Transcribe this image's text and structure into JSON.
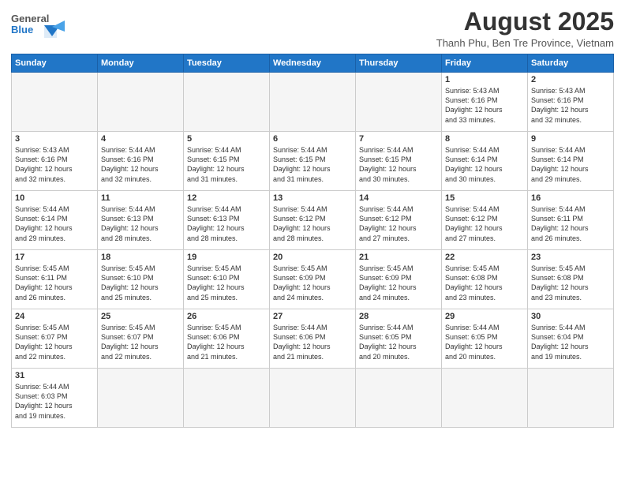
{
  "header": {
    "logo_text_general": "General",
    "logo_text_blue": "Blue",
    "month_title": "August 2025",
    "location": "Thanh Phu, Ben Tre Province, Vietnam"
  },
  "calendar": {
    "days_of_week": [
      "Sunday",
      "Monday",
      "Tuesday",
      "Wednesday",
      "Thursday",
      "Friday",
      "Saturday"
    ],
    "weeks": [
      [
        {
          "day": "",
          "info": ""
        },
        {
          "day": "",
          "info": ""
        },
        {
          "day": "",
          "info": ""
        },
        {
          "day": "",
          "info": ""
        },
        {
          "day": "",
          "info": ""
        },
        {
          "day": "1",
          "info": "Sunrise: 5:43 AM\nSunset: 6:16 PM\nDaylight: 12 hours\nand 33 minutes."
        },
        {
          "day": "2",
          "info": "Sunrise: 5:43 AM\nSunset: 6:16 PM\nDaylight: 12 hours\nand 32 minutes."
        }
      ],
      [
        {
          "day": "3",
          "info": "Sunrise: 5:43 AM\nSunset: 6:16 PM\nDaylight: 12 hours\nand 32 minutes."
        },
        {
          "day": "4",
          "info": "Sunrise: 5:44 AM\nSunset: 6:16 PM\nDaylight: 12 hours\nand 32 minutes."
        },
        {
          "day": "5",
          "info": "Sunrise: 5:44 AM\nSunset: 6:15 PM\nDaylight: 12 hours\nand 31 minutes."
        },
        {
          "day": "6",
          "info": "Sunrise: 5:44 AM\nSunset: 6:15 PM\nDaylight: 12 hours\nand 31 minutes."
        },
        {
          "day": "7",
          "info": "Sunrise: 5:44 AM\nSunset: 6:15 PM\nDaylight: 12 hours\nand 30 minutes."
        },
        {
          "day": "8",
          "info": "Sunrise: 5:44 AM\nSunset: 6:14 PM\nDaylight: 12 hours\nand 30 minutes."
        },
        {
          "day": "9",
          "info": "Sunrise: 5:44 AM\nSunset: 6:14 PM\nDaylight: 12 hours\nand 29 minutes."
        }
      ],
      [
        {
          "day": "10",
          "info": "Sunrise: 5:44 AM\nSunset: 6:14 PM\nDaylight: 12 hours\nand 29 minutes."
        },
        {
          "day": "11",
          "info": "Sunrise: 5:44 AM\nSunset: 6:13 PM\nDaylight: 12 hours\nand 28 minutes."
        },
        {
          "day": "12",
          "info": "Sunrise: 5:44 AM\nSunset: 6:13 PM\nDaylight: 12 hours\nand 28 minutes."
        },
        {
          "day": "13",
          "info": "Sunrise: 5:44 AM\nSunset: 6:12 PM\nDaylight: 12 hours\nand 28 minutes."
        },
        {
          "day": "14",
          "info": "Sunrise: 5:44 AM\nSunset: 6:12 PM\nDaylight: 12 hours\nand 27 minutes."
        },
        {
          "day": "15",
          "info": "Sunrise: 5:44 AM\nSunset: 6:12 PM\nDaylight: 12 hours\nand 27 minutes."
        },
        {
          "day": "16",
          "info": "Sunrise: 5:44 AM\nSunset: 6:11 PM\nDaylight: 12 hours\nand 26 minutes."
        }
      ],
      [
        {
          "day": "17",
          "info": "Sunrise: 5:45 AM\nSunset: 6:11 PM\nDaylight: 12 hours\nand 26 minutes."
        },
        {
          "day": "18",
          "info": "Sunrise: 5:45 AM\nSunset: 6:10 PM\nDaylight: 12 hours\nand 25 minutes."
        },
        {
          "day": "19",
          "info": "Sunrise: 5:45 AM\nSunset: 6:10 PM\nDaylight: 12 hours\nand 25 minutes."
        },
        {
          "day": "20",
          "info": "Sunrise: 5:45 AM\nSunset: 6:09 PM\nDaylight: 12 hours\nand 24 minutes."
        },
        {
          "day": "21",
          "info": "Sunrise: 5:45 AM\nSunset: 6:09 PM\nDaylight: 12 hours\nand 24 minutes."
        },
        {
          "day": "22",
          "info": "Sunrise: 5:45 AM\nSunset: 6:08 PM\nDaylight: 12 hours\nand 23 minutes."
        },
        {
          "day": "23",
          "info": "Sunrise: 5:45 AM\nSunset: 6:08 PM\nDaylight: 12 hours\nand 23 minutes."
        }
      ],
      [
        {
          "day": "24",
          "info": "Sunrise: 5:45 AM\nSunset: 6:07 PM\nDaylight: 12 hours\nand 22 minutes."
        },
        {
          "day": "25",
          "info": "Sunrise: 5:45 AM\nSunset: 6:07 PM\nDaylight: 12 hours\nand 22 minutes."
        },
        {
          "day": "26",
          "info": "Sunrise: 5:45 AM\nSunset: 6:06 PM\nDaylight: 12 hours\nand 21 minutes."
        },
        {
          "day": "27",
          "info": "Sunrise: 5:44 AM\nSunset: 6:06 PM\nDaylight: 12 hours\nand 21 minutes."
        },
        {
          "day": "28",
          "info": "Sunrise: 5:44 AM\nSunset: 6:05 PM\nDaylight: 12 hours\nand 20 minutes."
        },
        {
          "day": "29",
          "info": "Sunrise: 5:44 AM\nSunset: 6:05 PM\nDaylight: 12 hours\nand 20 minutes."
        },
        {
          "day": "30",
          "info": "Sunrise: 5:44 AM\nSunset: 6:04 PM\nDaylight: 12 hours\nand 19 minutes."
        }
      ],
      [
        {
          "day": "31",
          "info": "Sunrise: 5:44 AM\nSunset: 6:03 PM\nDaylight: 12 hours\nand 19 minutes."
        },
        {
          "day": "",
          "info": ""
        },
        {
          "day": "",
          "info": ""
        },
        {
          "day": "",
          "info": ""
        },
        {
          "day": "",
          "info": ""
        },
        {
          "day": "",
          "info": ""
        },
        {
          "day": "",
          "info": ""
        }
      ]
    ]
  }
}
